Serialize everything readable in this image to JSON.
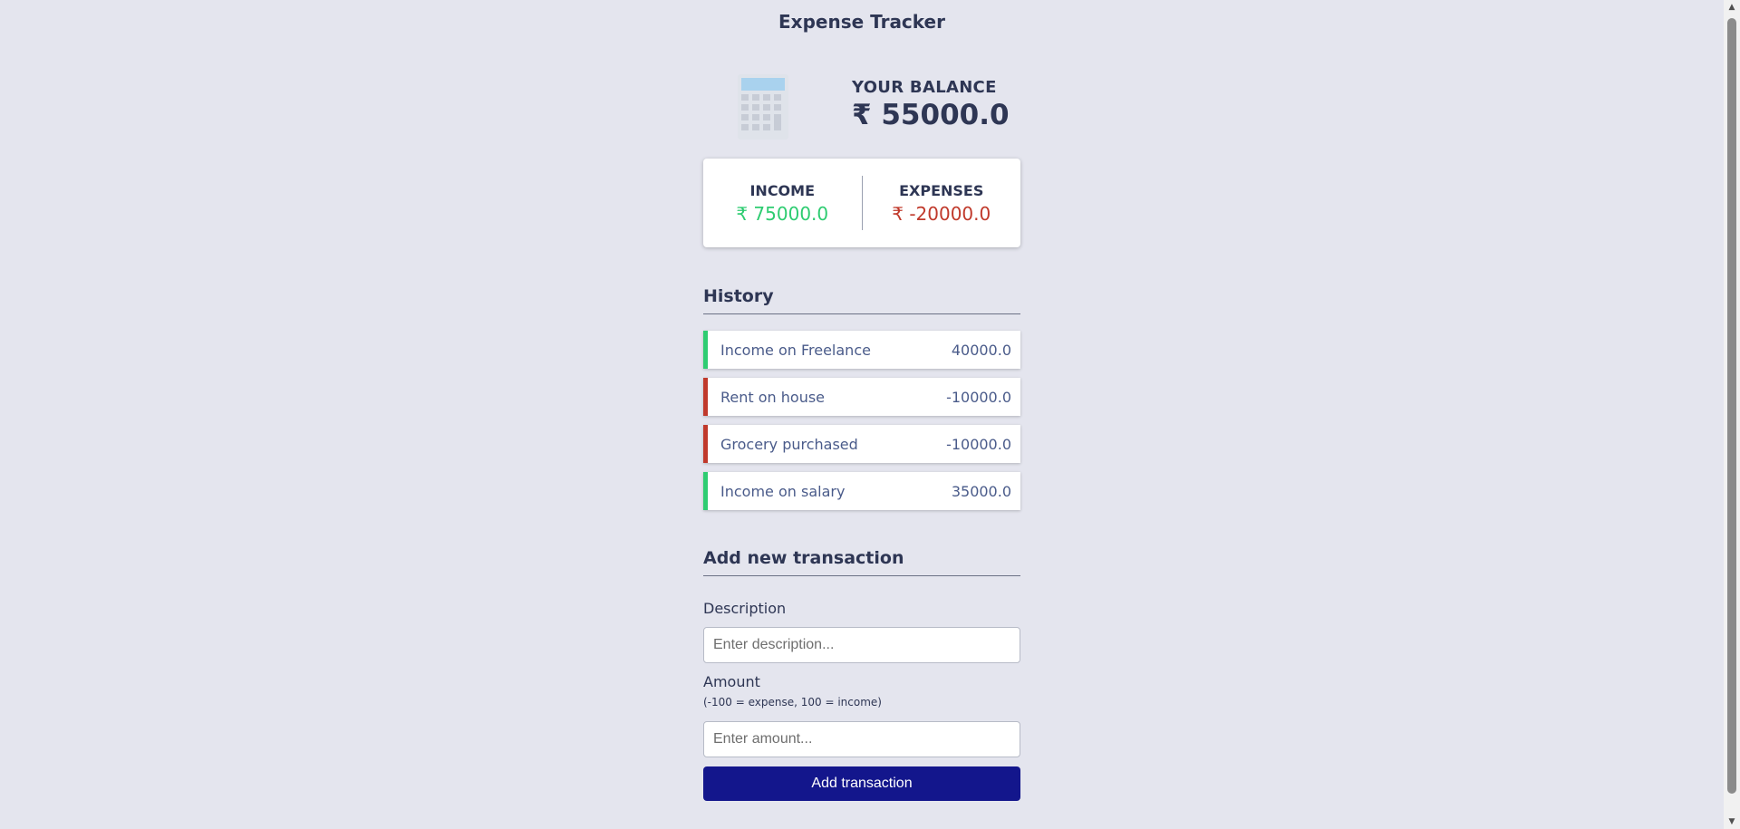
{
  "app": {
    "title": "Expense Tracker"
  },
  "balance": {
    "label": "YOUR BALANCE",
    "amount": "₹ 55000.0",
    "icon": "calculator-icon"
  },
  "summary": {
    "income_label": "INCOME",
    "income_value": "₹ 75000.0",
    "expense_label": "EXPENSES",
    "expense_value": "₹ -20000.0",
    "income_color": "#2ecc71",
    "expense_color": "#c0392b"
  },
  "history": {
    "heading": "History",
    "items": [
      {
        "text": "Income on Freelance",
        "amount": "40000.0",
        "type": "plus"
      },
      {
        "text": "Rent on house",
        "amount": "-10000.0",
        "type": "minus"
      },
      {
        "text": "Grocery purchased",
        "amount": "-10000.0",
        "type": "minus"
      },
      {
        "text": "Income on salary",
        "amount": "35000.0",
        "type": "plus"
      }
    ]
  },
  "form": {
    "heading": "Add new transaction",
    "description_label": "Description",
    "description_placeholder": "Enter description...",
    "description_value": "",
    "amount_label": "Amount",
    "amount_hint": "(-100 = expense, 100 = income)",
    "amount_placeholder": "Enter amount...",
    "amount_value": "",
    "submit_label": "Add transaction",
    "button_color": "#13168c"
  }
}
